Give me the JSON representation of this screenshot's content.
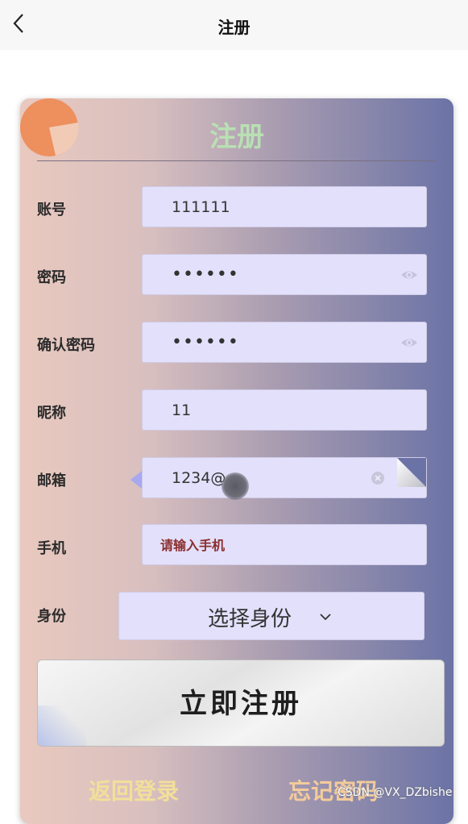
{
  "navbar": {
    "title": "注册"
  },
  "card": {
    "title": "注册",
    "account": {
      "label": "账号",
      "value": "111111"
    },
    "password": {
      "label": "密码",
      "value": "••••••"
    },
    "confirm_password": {
      "label": "确认密码",
      "value": "••••••"
    },
    "nickname": {
      "label": "昵称",
      "value": "11"
    },
    "email": {
      "label": "邮箱",
      "value": "1234@"
    },
    "phone": {
      "label": "手机",
      "placeholder": "请输入手机"
    },
    "identity": {
      "label": "身份",
      "selected": "选择身份"
    },
    "register_button": "立即注册",
    "back_to_login": "返回登录",
    "forgot_password": "忘记密码"
  },
  "watermark": "CSDN @VX_DZbishe",
  "colors": {
    "title_green": "#b9e0b3",
    "input_bg": "#e3e0fb",
    "link_yellow": "#f2df9a",
    "link_orange": "#f4cc9a",
    "placeholder_red": "#8b2e2e"
  },
  "icons": [
    "back-arrow-icon",
    "logo-icon",
    "eye-icon",
    "clear-icon",
    "chevron-down-icon"
  ]
}
